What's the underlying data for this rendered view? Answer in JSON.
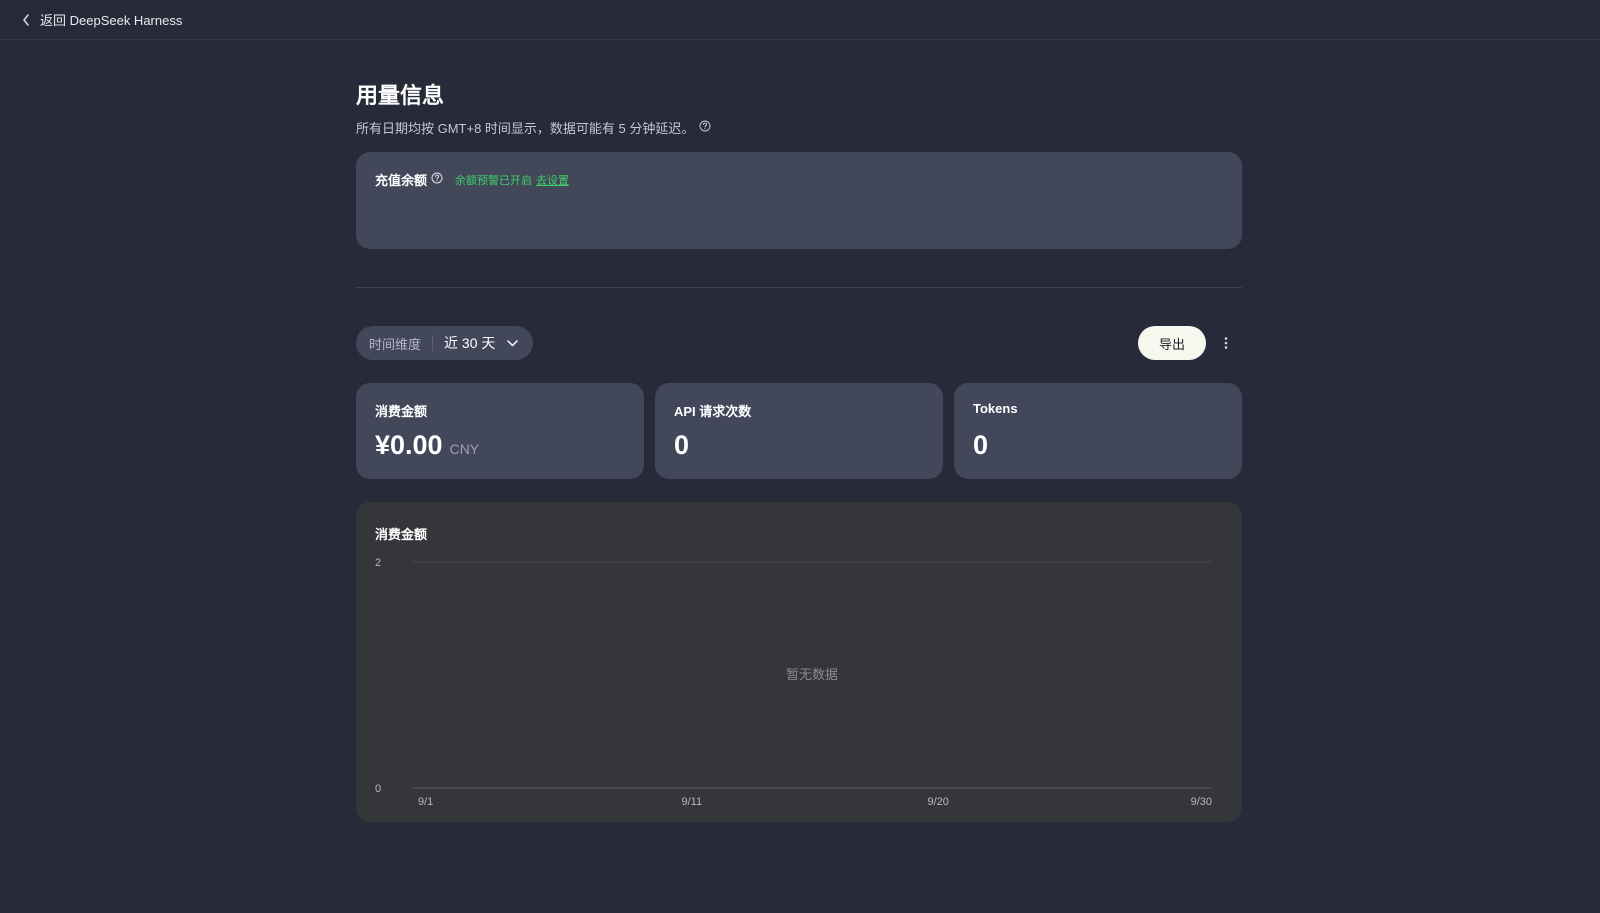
{
  "topbar": {
    "back_label": "返回 DeepSeek Harness"
  },
  "page": {
    "title": "用量信息",
    "subtitle": "所有日期均按 GMT+8 时间显示，数据可能有 5 分钟延迟。"
  },
  "balance": {
    "label": "充值余额",
    "alert_text": "余额预警已开启",
    "alert_link": "去设置"
  },
  "filter": {
    "label": "时间维度",
    "value": "近 30 天"
  },
  "actions": {
    "export_label": "导出"
  },
  "stats": [
    {
      "label": "消费金额",
      "value": "¥0.00",
      "unit": "CNY"
    },
    {
      "label": "API 请求次数",
      "value": "0"
    },
    {
      "label": "Tokens",
      "value": "0"
    }
  ],
  "chart_data": {
    "type": "line",
    "title": "消费金额",
    "x": [
      "9/1",
      "9/11",
      "9/20",
      "9/30"
    ],
    "series": [],
    "ylim": [
      0,
      2
    ],
    "yticks": [
      "2",
      "0"
    ],
    "empty_text": "暂无数据",
    "grid": true
  },
  "colors": {
    "background": "#272a38",
    "card": "#42475a",
    "chart_card": "#353639",
    "accent_green": "#3ecf6a",
    "export_button": "#f6f7ee"
  }
}
